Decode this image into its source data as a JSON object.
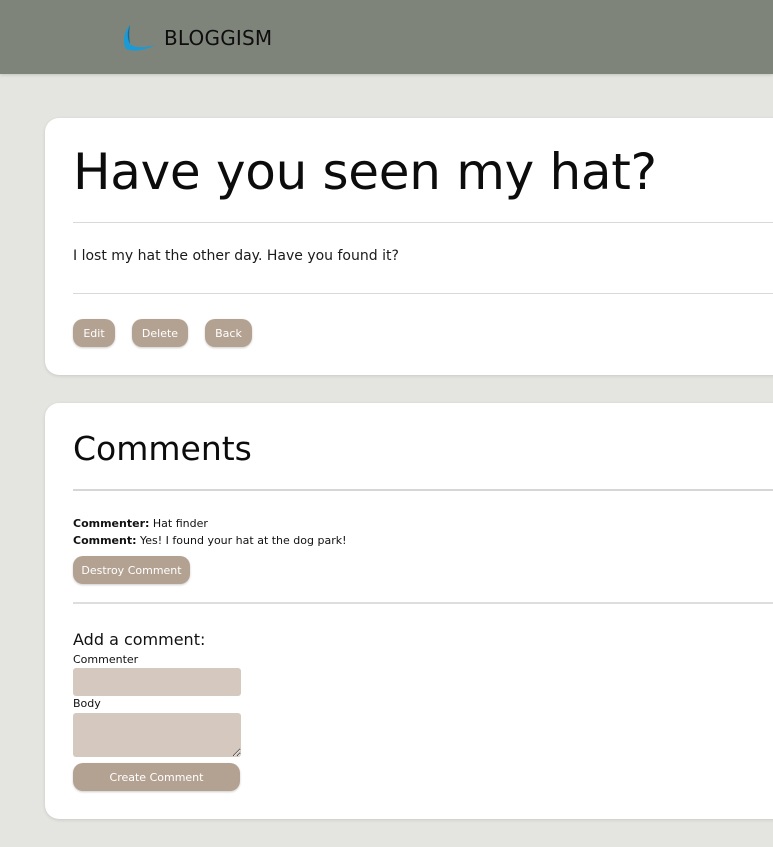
{
  "navbar": {
    "brand_name": "BLOGGISM",
    "brand_color": "#1a9ad6",
    "background": "#7f847b"
  },
  "post": {
    "title": "Have you seen my hat?",
    "body": "I lost my hat the other day. Have you found it?",
    "actions": {
      "edit_label": "Edit",
      "delete_label": "Delete",
      "back_label": "Back"
    }
  },
  "comments": {
    "heading": "Comments",
    "items": [
      {
        "commenter_label": "Commenter:",
        "commenter": "Hat finder",
        "comment_label": "Comment:",
        "body": "Yes! I found your hat at the dog park!",
        "destroy_label": "Destroy Comment"
      }
    ],
    "form": {
      "heading": "Add a comment:",
      "commenter_label": "Commenter",
      "commenter_value": "",
      "body_label": "Body",
      "body_value": "",
      "submit_label": "Create Comment"
    }
  },
  "colors": {
    "page_background": "#e4e4e0",
    "button": "#b3a292",
    "input": "#d5c9bf"
  }
}
